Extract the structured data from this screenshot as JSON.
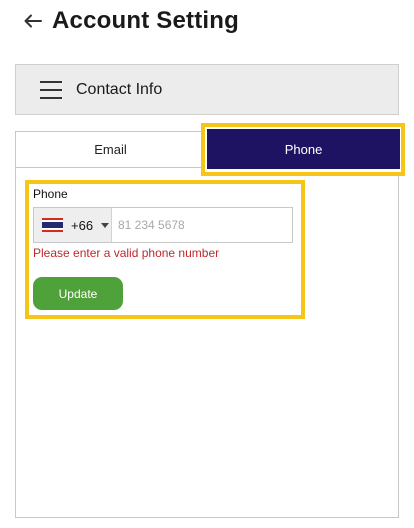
{
  "header": {
    "title": "Account Setting",
    "back_icon": "arrow-left-icon"
  },
  "section": {
    "title": "Contact Info",
    "menu_icon": "hamburger-menu-icon"
  },
  "tabs": [
    {
      "label": "Email",
      "active": false
    },
    {
      "label": "Phone",
      "active": true
    }
  ],
  "phone_form": {
    "label": "Phone",
    "country_code": "+66",
    "country_flag": "thailand-flag-icon",
    "value": "",
    "placeholder": "81 234 5678",
    "error": "Please enter a valid phone number",
    "submit_label": "Update"
  },
  "colors": {
    "active_tab": "#1e1363",
    "highlight": "#f5c518",
    "error": "#c0282b",
    "button": "#4fa239"
  }
}
